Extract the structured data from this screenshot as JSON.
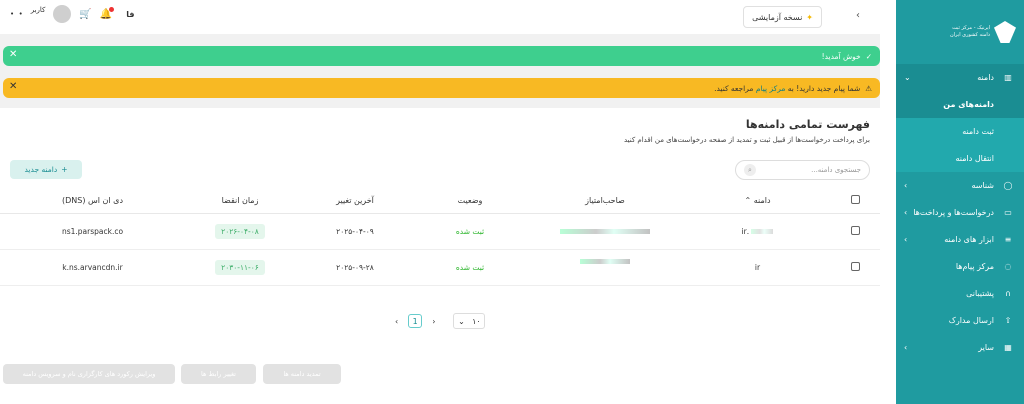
{
  "sidebar": {
    "logo_lines": [
      "ایرنیک - مرکز ثبت",
      "دامنه کشوری ایران"
    ],
    "items": [
      {
        "label": "دامنه",
        "icon": "chart-icon",
        "open": true
      },
      {
        "label": "دامنه‌های من",
        "sub": true,
        "active": true
      },
      {
        "label": "ثبت دامنه",
        "sub": true
      },
      {
        "label": "انتقال دامنه",
        "sub": true
      },
      {
        "label": "شناسه",
        "icon": "user-icon"
      },
      {
        "label": "درخواست‌ها و پرداخت‌ها",
        "icon": "card-icon"
      },
      {
        "label": "ابزار های دامنه",
        "icon": "sliders-icon"
      },
      {
        "label": "مرکز پیام‌ها",
        "icon": "message-icon"
      },
      {
        "label": "پشتیبانی",
        "icon": "headset-icon"
      },
      {
        "label": "ارسال مدارک",
        "icon": "upload-icon"
      },
      {
        "label": "سایر",
        "icon": "grid-icon"
      }
    ]
  },
  "topbar": {
    "trial_label": "نسخه آزمایشی",
    "user_label": "کاربر",
    "lang": "فا"
  },
  "alerts": {
    "welcome": "خوش آمدید!",
    "message_prefix": "شما پیام جدید دارید! به",
    "message_link": "مرکز پیام",
    "message_suffix": "مراجعه کنید."
  },
  "card": {
    "title": "فهرست تمامی دامنه‌ها",
    "subtitle": "برای پرداخت درخواست‌ها از قبیل ثبت و تمدید از صفحه درخواست‌های من اقدام کنید",
    "new_button": "دامنه جدید",
    "search_placeholder": "جستجوی دامنه..."
  },
  "table": {
    "headers": [
      "دامنه",
      "صاحب‌امتیاز",
      "وضعیت",
      "آخرین تغییر",
      "زمان انقضا",
      "دی ان اس (DNS)"
    ],
    "rows": [
      {
        "domain": ".ir",
        "status": "ثبت شده",
        "last_change": "۲۰۲۵-۰۴-۰۹",
        "expiry": "۲۰۲۶-۰۴-۰۸",
        "dns": "ns1.parspack.co"
      },
      {
        "domain": "ir",
        "status": "ثبت شده",
        "last_change": "۲۰۲۵-۰۹-۲۸",
        "expiry": "۲۰۳۰-۱۱-۰۶",
        "dns": "k.ns.arvancdn.ir"
      }
    ]
  },
  "pagination": {
    "page": "1",
    "page_size": "۱۰"
  },
  "actions": [
    "تمدید دامنه ها",
    "تغییر رابط ها",
    "ویرایش رکورد های کارگزاری نام و سرویس دامنه"
  ]
}
